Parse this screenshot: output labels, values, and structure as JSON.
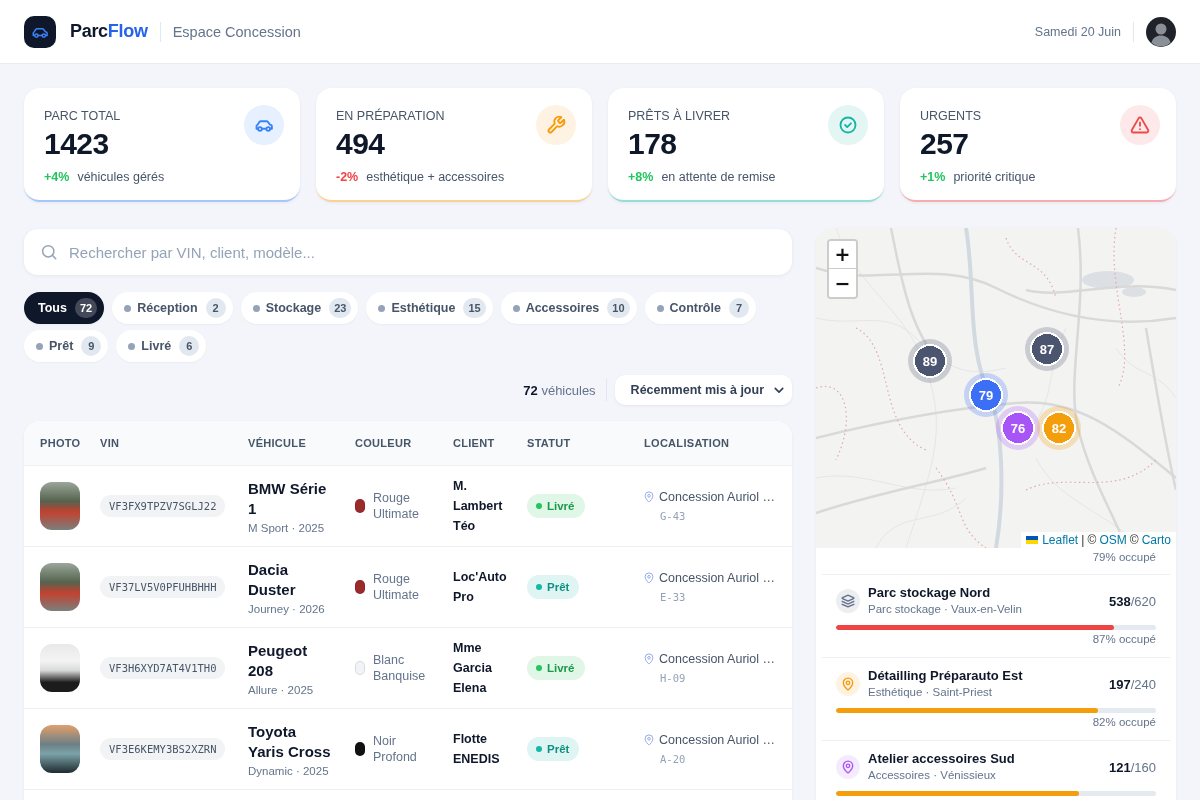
{
  "header": {
    "brand": {
      "primary": "Parc",
      "accent": "Flow"
    },
    "workspace": "Espace Concession",
    "date": "Samedi 20 Juin"
  },
  "stats": [
    {
      "label": "PARC TOTAL",
      "value": "1423",
      "delta": "+4%",
      "positive": true,
      "caption": "véhicules gérés",
      "kind": "car",
      "color": "#e7f0fe"
    },
    {
      "label": "EN PRÉPARATION",
      "value": "494",
      "delta": "-2%",
      "positive": false,
      "caption": "esthétique + accessoires",
      "kind": "wrench",
      "color": "#fef3e2"
    },
    {
      "label": "PRÊTS À LIVRER",
      "value": "178",
      "delta": "+8%",
      "positive": true,
      "caption": "en attente de remise",
      "kind": "check",
      "color": "#e3f6f4"
    },
    {
      "label": "URGENTS",
      "value": "257",
      "delta": "+1%",
      "positive": true,
      "caption": "priorité critique",
      "kind": "alert",
      "color": "#fde9e9"
    }
  ],
  "search": {
    "placeholder": "Rechercher par VIN, client, modèle..."
  },
  "filters": [
    {
      "label": "Tous",
      "count": "72",
      "kind": "all",
      "selected": true
    },
    {
      "label": "Réception",
      "count": "2",
      "kind": "status",
      "selected": false
    },
    {
      "label": "Stockage",
      "count": "23",
      "kind": "status",
      "selected": false
    },
    {
      "label": "Esthétique",
      "count": "15",
      "kind": "status",
      "selected": false
    },
    {
      "label": "Accessoires",
      "count": "10",
      "kind": "status",
      "selected": false
    },
    {
      "label": "Contrôle",
      "count": "7",
      "kind": "status",
      "selected": false
    },
    {
      "label": "Prêt",
      "count": "9",
      "kind": "status",
      "selected": false
    },
    {
      "label": "Livré",
      "count": "6",
      "kind": "status",
      "selected": false
    }
  ],
  "results": {
    "count": "**72** véhicules",
    "sort": "Récemment mis à jour"
  },
  "table": {
    "columns": [
      "PHOTO",
      "VIN",
      "VÉHICULE",
      "COULEUR",
      "CLIENT",
      "STATUT",
      "LOCALISATION"
    ],
    "rows": [
      {
        "vin": "VF3FX9TPZV7SGLJ22",
        "model": "BMW Série 1",
        "trim": "M Sport · 2025",
        "paint": "Rouge Ultimate",
        "color": "#9b2a2a",
        "client": "M. Lambert Téo",
        "status": {
          "label": "Livré",
          "color": "#22c55e"
        },
        "location": "Concession Auriol …",
        "slot": "G-43"
      },
      {
        "vin": "VF37LV5V0PFUHBHHH",
        "model": "Dacia Duster",
        "trim": "Journey · 2026",
        "paint": "Rouge Ultimate",
        "color": "#9b2a2a",
        "client": "Loc'Auto Pro",
        "status": {
          "label": "Prêt",
          "color": "#14b8a6"
        },
        "location": "Concession Auriol …",
        "slot": "E-33"
      },
      {
        "vin": "VF3H6XYD7AT4V1TH0",
        "model": "Peugeot 208",
        "trim": "Allure · 2025",
        "paint": "Blanc Banquise",
        "color": "#f1f3f6",
        "client": "Mme Garcia Elena",
        "status": {
          "label": "Livré",
          "color": "#22c55e"
        },
        "location": "Concession Auriol …",
        "slot": "H-09"
      },
      {
        "vin": "VF3E6KEMY3BS2XZRN",
        "model": "Toyota Yaris Cross",
        "trim": "Dynamic · 2025",
        "paint": "Noir Profond",
        "color": "#111111",
        "client": "Flotte ENEDIS",
        "status": {
          "label": "Prêt",
          "color": "#14b8a6"
        },
        "location": "Concession Auriol …",
        "slot": "A-20"
      }
    ]
  },
  "map": {
    "zoom_in": "+",
    "zoom_out": "−",
    "clusters": [
      {
        "count": "89",
        "color": "#4b5570"
      },
      {
        "count": "87",
        "color": "#4b5570"
      },
      {
        "count": "79",
        "color": "#3b6ff5"
      },
      {
        "count": "76",
        "color": "#a855f7"
      },
      {
        "count": "82",
        "color": "#f59e0b"
      }
    ],
    "attribution": [
      {
        "text": "Leaflet",
        "kind": "link"
      },
      {
        "text": "| ©",
        "kind": "text"
      },
      {
        "text": "OSM",
        "kind": "link"
      },
      {
        "text": "©",
        "kind": "text"
      },
      {
        "text": "Carto",
        "kind": "link"
      }
    ]
  },
  "sites": [
    {
      "occupancy": "79% occupé"
    },
    {
      "name": "Parc stockage Nord",
      "subtitle": "Parc stockage · Vaux-en-Velin",
      "load": "**538**/620",
      "level": 0.87,
      "occupancy": "87% occupé",
      "kind": "storage",
      "color": "#eceef1"
    },
    {
      "name": "Détailling Préparauto Est",
      "subtitle": "Esthétique · Saint-Priest",
      "load": "**197**/240",
      "level": 0.82,
      "occupancy": "82% occupé",
      "kind": "pin",
      "color": "#fef3e2"
    },
    {
      "name": "Atelier accessoires Sud",
      "subtitle": "Accessoires · Vénissieux",
      "load": "**121**/160",
      "level": 0.76,
      "kind": "pin",
      "color": "#f5ebfe"
    }
  ]
}
